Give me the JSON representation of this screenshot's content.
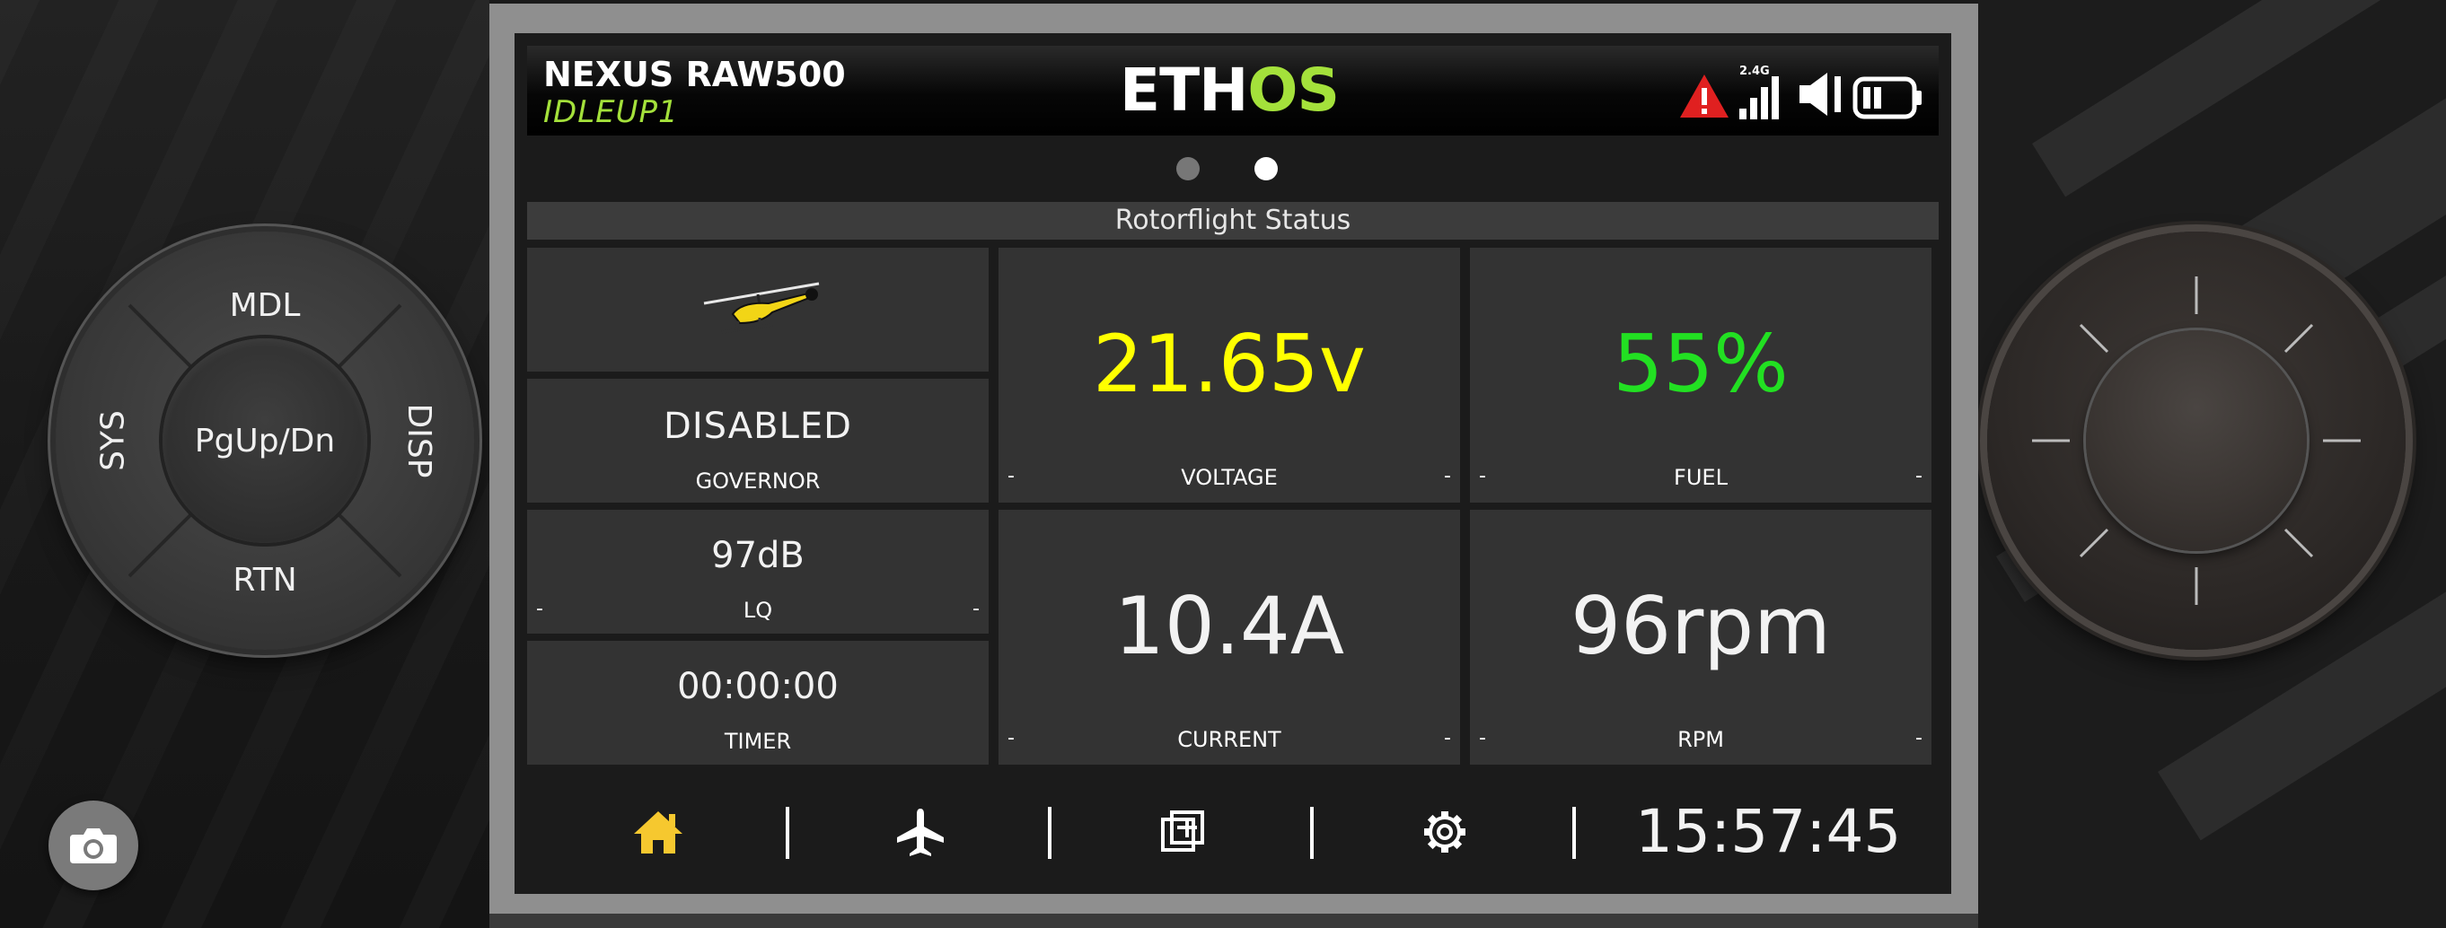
{
  "header": {
    "model_name": "NEXUS RAW500",
    "flight_mode": "IDLEUP1",
    "brand_left": "ETH",
    "brand_right": "OS",
    "band": "2.4G"
  },
  "pager": {
    "page_count": 2,
    "active_page": 2
  },
  "widget_title": "Rotorflight Status",
  "tiles": {
    "governor": {
      "value": "DISABLED",
      "label": "GOVERNOR"
    },
    "lq": {
      "value": "97dB",
      "label": "LQ",
      "min": "-",
      "max": "-"
    },
    "timer": {
      "value": "00:00:00",
      "label": "TIMER"
    },
    "voltage": {
      "value": "21.65v",
      "label": "VOLTAGE",
      "min": "-",
      "max": "-",
      "color": "#ffff00"
    },
    "current": {
      "value": "10.4A",
      "label": "CURRENT",
      "min": "-",
      "max": "-"
    },
    "fuel": {
      "value": "55%",
      "label": "FUEL",
      "min": "-",
      "max": "-",
      "color": "#22e022"
    },
    "rpm": {
      "value": "96rpm",
      "label": "RPM",
      "min": "-",
      "max": "-"
    }
  },
  "nav": {
    "items": [
      {
        "name": "home",
        "icon": "home-icon",
        "active": true
      },
      {
        "name": "model",
        "icon": "airplane-icon"
      },
      {
        "name": "display",
        "icon": "widgets-icon"
      },
      {
        "name": "system",
        "icon": "gear-icon"
      }
    ],
    "clock": "15:57:45"
  },
  "hardware": {
    "dpad": {
      "top": "MDL",
      "bottom": "RTN",
      "left": "SYS",
      "right": "DISP",
      "center": "PgUp/Dn"
    },
    "screenshot_icon": "camera-icon"
  },
  "colors": {
    "accent_green": "#a4e13b",
    "alert_red": "#e02020",
    "home_active": "#f6c82f"
  }
}
